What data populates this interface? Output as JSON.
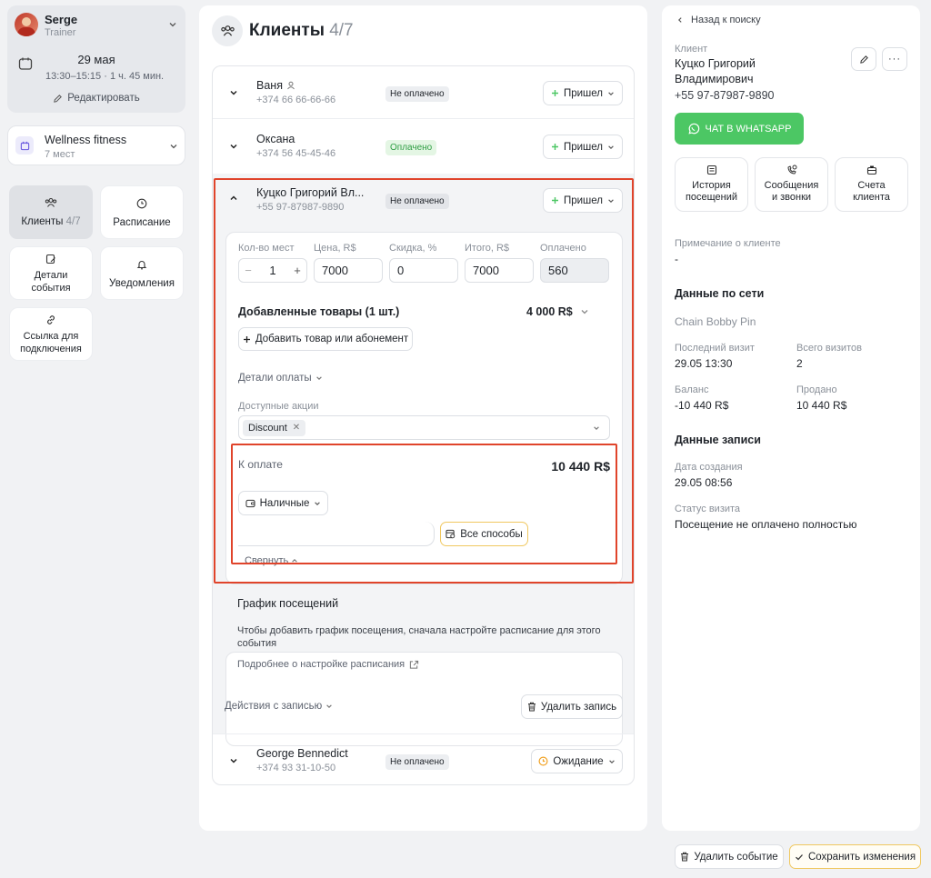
{
  "trainer": {
    "name": "Serge",
    "role": "Trainer"
  },
  "event": {
    "date": "29 мая",
    "time": "13:30–15:15 · 1 ч. 45 мин.",
    "edit_label": "Редактировать"
  },
  "venue": {
    "name": "Wellness fitness",
    "seats": "7 мест"
  },
  "nav": {
    "clients": {
      "label": "Клиенты",
      "count": "4/7"
    },
    "schedule": "Расписание",
    "details": "Детали события",
    "notifications": "Уведомления",
    "link": "Ссылка для подключения"
  },
  "main": {
    "title": "Клиенты",
    "count": "4/7",
    "clients": [
      {
        "name": "Ваня",
        "phone": "+374 66 66-66-66",
        "status": "Не оплачено",
        "attendance": "Пришел"
      },
      {
        "name": "Оксана",
        "phone": "+374 56 45-45-46",
        "status": "Оплачено",
        "attendance": "Пришел"
      },
      {
        "name": "Куцко Григорий Вл...",
        "phone": "+55 97-87987-9890",
        "status": "Не оплачено",
        "attendance": "Пришел"
      },
      {
        "name": "George Bennedict",
        "phone": "+374 93 31-10-50",
        "status": "Не оплачено",
        "attendance": "Ожидание"
      }
    ],
    "form": {
      "qty_label": "Кол-во мест",
      "qty_value": "1",
      "price_label": "Цена, R$",
      "price_value": "7000",
      "discount_label": "Скидка, %",
      "discount_value": "0",
      "total_label": "Итого, R$",
      "total_value": "7000",
      "paid_label": "Оплачено",
      "paid_value": "560",
      "products_title": "Добавленные товары (1 шт.)",
      "products_total": "4 000 R$",
      "add_product": "Добавить товар или абонемент",
      "payment_details": "Детали оплаты",
      "promos_label": "Доступные акции",
      "promo_tag": "Discount",
      "to_pay_label": "К оплате",
      "to_pay_value": "10 440 R$",
      "method": "Наличные",
      "all_methods": "Все способы",
      "collapse": "Свернуть"
    },
    "schedule_box": {
      "title": "График посещений",
      "text": "Чтобы добавить график посещения, сначала настройте расписание для этого события",
      "link": "Подробнее о настройке расписания"
    },
    "record_actions": "Действия с записью",
    "delete_record": "Удалить запись"
  },
  "right": {
    "back": "Назад к поиску",
    "client_label": "Клиент",
    "client_name_1": "Куцко Григорий",
    "client_name_2": "Владимирович",
    "client_phone": "+55 97-87987-9890",
    "whatsapp": "ЧАТ В WHATSAPP",
    "tiles": {
      "history": "История посещений",
      "messages": "Сообщения и звонки",
      "accounts": "Счета клиента"
    },
    "note_label": "Примечание о клиенте",
    "note_value": "-",
    "network_title": "Данные по сети",
    "network_name": "Chain Bobby Pin",
    "last_visit_label": "Последний визит",
    "last_visit_value": "29.05 13:30",
    "total_visits_label": "Всего визитов",
    "total_visits_value": "2",
    "balance_label": "Баланс",
    "balance_value": "-10 440 R$",
    "sold_label": "Продано",
    "sold_value": "10 440 R$",
    "record_title": "Данные записи",
    "created_label": "Дата создания",
    "created_value": "29.05 08:56",
    "visit_status_label": "Статус визита",
    "visit_status_value": "Посещение не оплачено полностью"
  },
  "footer": {
    "delete_event": "Удалить событие",
    "save": "Сохранить изменения"
  },
  "colors": {
    "accent": "#4cc764",
    "warning": "#f0a020",
    "highlight": "#e0442b",
    "paid": "#2f9e44"
  }
}
